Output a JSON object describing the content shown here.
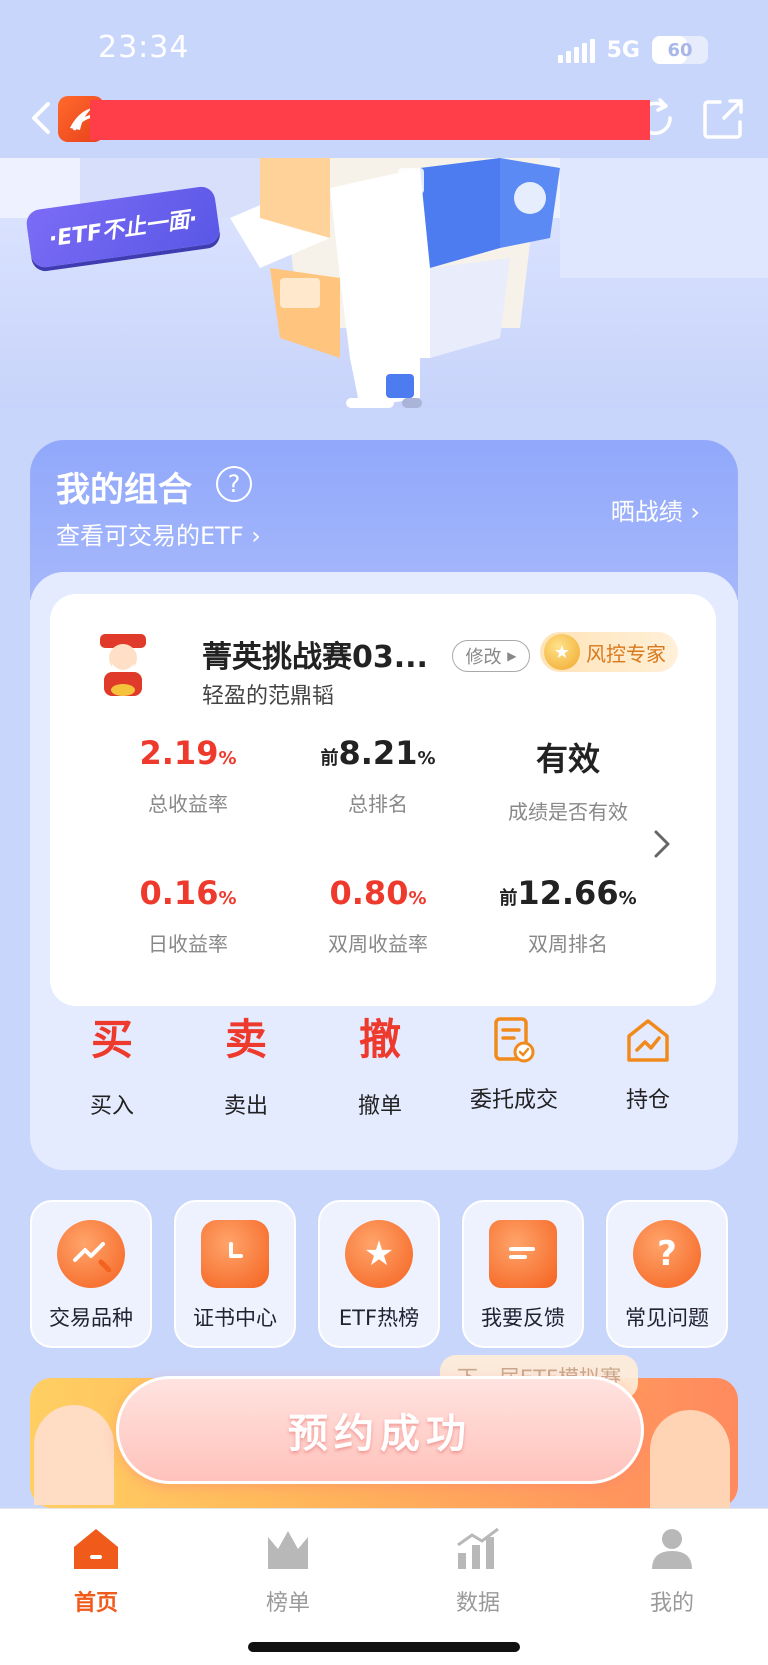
{
  "status_bar": {
    "time": "23:34",
    "network": "5G",
    "battery": "60"
  },
  "banner": {
    "tag": "·ETF不止一面·"
  },
  "portfolio": {
    "title": "我的组合",
    "subtitle": "查看可交易的ETF",
    "share_label": "晒战绩",
    "competition_name": "菁英挑战赛03...",
    "modify_label": "修改",
    "badge_label": "风控专家",
    "nickname": "轻盈的范鼎韬",
    "stats": {
      "total_return": {
        "value": "2.19",
        "unit": "%",
        "label": "总收益率"
      },
      "total_rank": {
        "prefix": "前",
        "value": "8.21",
        "unit": "%",
        "label": "总排名"
      },
      "validity": {
        "value": "有效",
        "label": "成绩是否有效"
      },
      "daily_return": {
        "value": "0.16",
        "unit": "%",
        "label": "日收益率"
      },
      "biweekly_return": {
        "value": "0.80",
        "unit": "%",
        "label": "双周收益率"
      },
      "biweekly_rank": {
        "prefix": "前",
        "value": "12.66",
        "unit": "%",
        "label": "双周排名"
      }
    },
    "actions": {
      "buy": {
        "glyph": "买",
        "label": "买入"
      },
      "sell": {
        "glyph": "卖",
        "label": "卖出"
      },
      "cancel": {
        "glyph": "撤",
        "label": "撤单"
      },
      "orders": {
        "label": "委托成交"
      },
      "holdings": {
        "label": "持仓"
      }
    }
  },
  "shortcuts": [
    {
      "label": "交易品种",
      "icon": "trend-icon"
    },
    {
      "label": "证书中心",
      "icon": "clock-icon"
    },
    {
      "label": "ETF热榜",
      "icon": "medal-icon"
    },
    {
      "label": "我要反馈",
      "icon": "feedback-icon"
    },
    {
      "label": "常见问题",
      "icon": "question-icon"
    }
  ],
  "promo": {
    "tab_label": "下一届ETF模拟赛",
    "button_label": "预约成功"
  },
  "tabbar": {
    "home": "首页",
    "ranking": "榜单",
    "data": "数据",
    "mine": "我的"
  },
  "colors": {
    "accent_red": "#ee3a2c",
    "active_tab": "#f05a1a",
    "inactive_tab": "#9a9a9a",
    "header_blue": "#91a8fb"
  }
}
